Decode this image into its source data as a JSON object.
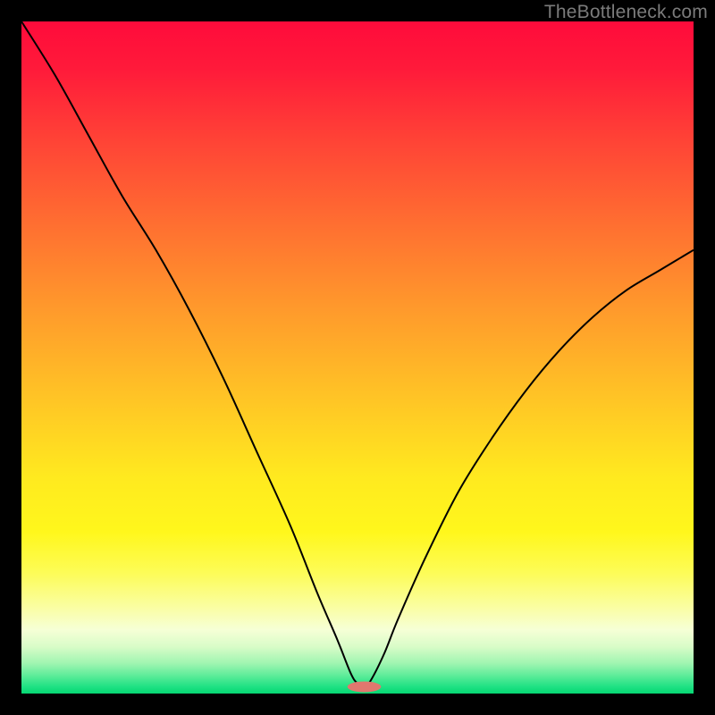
{
  "watermark": "TheBottleneck.com",
  "chart_data": {
    "type": "line",
    "title": "",
    "xlabel": "",
    "ylabel": "",
    "xlim": [
      0,
      100
    ],
    "ylim": [
      0,
      100
    ],
    "grid": false,
    "legend": false,
    "description": "Bottleneck deviation curve. The vertical axis encodes bottleneck severity (heatmap from red at top through yellow to green at bottom). The black V-shaped curve reaches its minimum near x ≈ 51 indicating the balanced point.",
    "series": [
      {
        "name": "bottleneck-curve",
        "x": [
          0,
          5,
          10,
          15,
          20,
          25,
          30,
          35,
          40,
          44,
          47,
          49,
          50,
          51,
          52,
          54,
          56,
          60,
          65,
          70,
          75,
          80,
          85,
          90,
          95,
          100
        ],
        "values": [
          100,
          92,
          83,
          74,
          66,
          57,
          47,
          36,
          25,
          15,
          8,
          3,
          1.5,
          1,
          2,
          6,
          11,
          20,
          30,
          38,
          45,
          51,
          56,
          60,
          63,
          66
        ]
      }
    ],
    "marker": {
      "x": 51,
      "y": 1,
      "rx": 2.5,
      "ry": 0.8,
      "fill": "#e1776e"
    },
    "gradient_stops": [
      {
        "offset": 0.0,
        "color": "#ff0b3b"
      },
      {
        "offset": 0.07,
        "color": "#ff1a3a"
      },
      {
        "offset": 0.18,
        "color": "#ff4436"
      },
      {
        "offset": 0.3,
        "color": "#ff6e31"
      },
      {
        "offset": 0.42,
        "color": "#ff972c"
      },
      {
        "offset": 0.55,
        "color": "#ffc126"
      },
      {
        "offset": 0.68,
        "color": "#ffea1f"
      },
      {
        "offset": 0.76,
        "color": "#fff71c"
      },
      {
        "offset": 0.82,
        "color": "#fdfc57"
      },
      {
        "offset": 0.87,
        "color": "#fafea0"
      },
      {
        "offset": 0.905,
        "color": "#f6ffd6"
      },
      {
        "offset": 0.93,
        "color": "#d9fcc8"
      },
      {
        "offset": 0.955,
        "color": "#a0f5b1"
      },
      {
        "offset": 0.975,
        "color": "#57eb97"
      },
      {
        "offset": 0.99,
        "color": "#1ee183"
      },
      {
        "offset": 1.0,
        "color": "#06d873"
      }
    ]
  }
}
